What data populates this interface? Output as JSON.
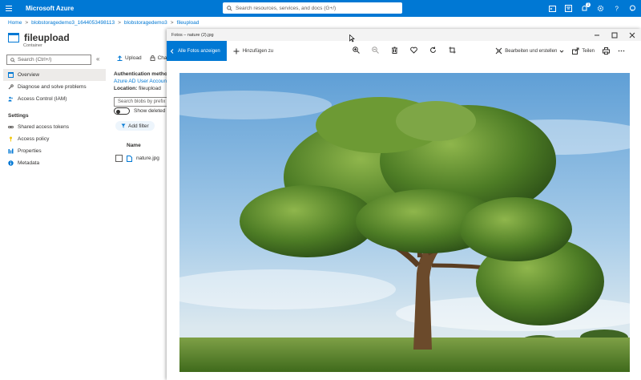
{
  "azure": {
    "brand": "Microsoft Azure",
    "search_placeholder": "Search resources, services, and docs (G+/)",
    "notification_count": "1"
  },
  "breadcrumb": [
    "Home",
    "blobstoragedemo3_1644053498113",
    "blobstoragedemo3",
    "fileupload"
  ],
  "container": {
    "title": "fileupload",
    "subtitle": "Container"
  },
  "left_nav": {
    "search_placeholder": "Search (Ctrl+/)",
    "items": [
      {
        "label": "Overview",
        "icon": "container-icon",
        "active": true
      },
      {
        "label": "Diagnose and solve problems",
        "icon": "wrench-icon"
      },
      {
        "label": "Access Control (IAM)",
        "icon": "people-icon"
      }
    ],
    "settings_header": "Settings",
    "settings_items": [
      {
        "label": "Shared access tokens",
        "icon": "link-icon"
      },
      {
        "label": "Access policy",
        "icon": "key-icon"
      },
      {
        "label": "Properties",
        "icon": "bars-icon"
      },
      {
        "label": "Metadata",
        "icon": "info-icon"
      }
    ]
  },
  "container_pane": {
    "upload": "Upload",
    "change": "Cha",
    "auth_heading": "Authentication metho",
    "auth_value": "Azure AD User Account",
    "location_label": "Location:",
    "location_value": "fileupload",
    "blob_search_placeholder": "Search blobs by prefix",
    "show_deleted": "Show deleted",
    "add_filter": "Add filter",
    "column_name": "Name",
    "rows": [
      {
        "name": "nature.jpg"
      }
    ]
  },
  "photos": {
    "title": "Fotos – nature (2).jpg",
    "all_photos": "Alle Fotos anzeigen",
    "add_to": "Hinzufügen zu",
    "edit_create": "Bearbeiten und erstellen",
    "share": "Teilen",
    "colors": {
      "accent": "#0078d4"
    }
  }
}
